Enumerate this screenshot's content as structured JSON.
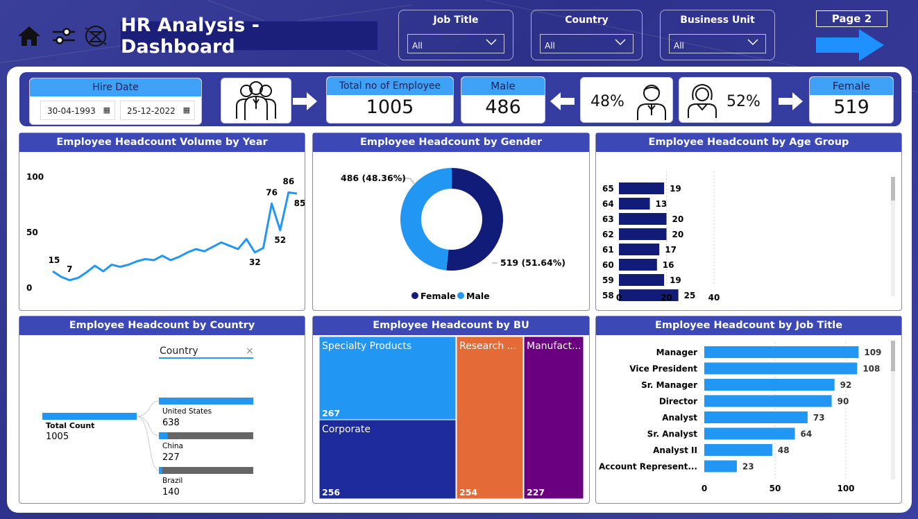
{
  "header": {
    "title": "HR Analysis - Dashboard",
    "icons": [
      "home-icon",
      "filter-sliders-icon",
      "time-globe-icon"
    ],
    "slicers": [
      {
        "label": "Job Title",
        "value": "All"
      },
      {
        "label": "Country",
        "value": "All"
      },
      {
        "label": "Business Unit",
        "value": "All"
      }
    ],
    "page_button": "Page 2"
  },
  "kpis": {
    "hire_date_label": "Hire Date",
    "hire_date_from": "30-04-1993",
    "hire_date_to": "25-12-2022",
    "total_label": "Total no of Employee",
    "total_value": "1005",
    "male_label": "Male",
    "male_value": "486",
    "male_pct": "48%",
    "female_pct": "52%",
    "female_label": "Female",
    "female_value": "519"
  },
  "panels": {
    "by_year": "Employee Headcount Volume by Year",
    "by_gender": "Employee Headcount by Gender",
    "by_age": "Employee Headcount by Age Group",
    "by_country": "Employee Headcount by Country",
    "by_bu": "Employee Headcount by BU",
    "by_job": "Employee Headcount by Job Title"
  },
  "colors": {
    "dark_navy": "#101c78",
    "light_blue": "#2196f3",
    "orange": "#e46b38",
    "purple": "#6a0080",
    "header_blue": "#3b48b5"
  },
  "chart_data": [
    {
      "type": "line",
      "title": "Employee Headcount Volume by Year",
      "x": [
        1993,
        1994,
        1995,
        1996,
        1997,
        1998,
        1999,
        2000,
        2001,
        2002,
        2003,
        2004,
        2005,
        2006,
        2007,
        2008,
        2009,
        2010,
        2011,
        2012,
        2013,
        2014,
        2015,
        2016,
        2017,
        2018,
        2019,
        2020,
        2021,
        2022
      ],
      "y": [
        15,
        10,
        7,
        9,
        14,
        20,
        15,
        21,
        19,
        21,
        24,
        26,
        25,
        29,
        25,
        28,
        32,
        35,
        33,
        37,
        41,
        38,
        35,
        44,
        32,
        36,
        76,
        52,
        86,
        85
      ],
      "xticks": [
        "2000",
        "2010",
        "2020"
      ],
      "yticks": [
        "0",
        "50",
        "100"
      ],
      "ylim": [
        0,
        100
      ],
      "labeled_points": [
        {
          "x": 1993,
          "label": "15"
        },
        {
          "x": 1995,
          "label": "7"
        },
        {
          "x": 2017,
          "label": "32"
        },
        {
          "x": 2019,
          "label": "76"
        },
        {
          "x": 2020,
          "label": "52"
        },
        {
          "x": 2021,
          "label": "86"
        },
        {
          "x": 2022,
          "label": "85"
        }
      ]
    },
    {
      "type": "pie",
      "title": "Employee Headcount by Gender",
      "categories": [
        "Female",
        "Male"
      ],
      "values": [
        519,
        486
      ],
      "labels": [
        "519 (51.64%)",
        "486 (48.36%)"
      ],
      "legend": [
        "Female",
        "Male"
      ]
    },
    {
      "type": "bar",
      "title": "Employee Headcount by Age Group",
      "categories": [
        "65",
        "64",
        "63",
        "62",
        "61",
        "60",
        "59",
        "58"
      ],
      "values": [
        19,
        13,
        20,
        20,
        17,
        16,
        19,
        25
      ],
      "xticks": [
        "0",
        "20",
        "40"
      ],
      "xlim": [
        0,
        48
      ]
    },
    {
      "type": "table",
      "title": "Employee Headcount by Country",
      "filter_label": "Country",
      "total_label": "Total Count",
      "total_value": "1005",
      "categories": [
        "United States",
        "China",
        "Brazil"
      ],
      "values": [
        638,
        227,
        140
      ]
    },
    {
      "type": "table",
      "title": "Employee Headcount by BU",
      "categories": [
        "Specialty Products",
        "Corporate",
        "Research ...",
        "Manufact..."
      ],
      "values": [
        267,
        256,
        254,
        227
      ]
    },
    {
      "type": "bar",
      "title": "Employee Headcount by Job Title",
      "categories": [
        "Manager",
        "Vice President",
        "Sr. Manager",
        "Director",
        "Analyst",
        "Sr. Analyst",
        "Analyst II",
        "Account Represent..."
      ],
      "values": [
        109,
        108,
        92,
        90,
        73,
        64,
        48,
        23
      ],
      "xticks": [
        "0",
        "50",
        "100"
      ],
      "xlim": [
        0,
        120
      ]
    }
  ]
}
